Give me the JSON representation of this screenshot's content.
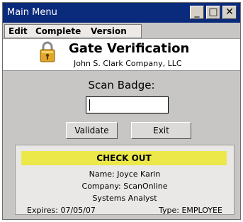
{
  "window": {
    "title": "Main Menu"
  },
  "titlebar_buttons": {
    "minimize": "_",
    "maximize": "□",
    "close": "✕"
  },
  "menu": [
    "Edit",
    "Complete",
    "Version"
  ],
  "header": {
    "title": "Gate Verification",
    "subtitle": "John S. Clark Company, LLC",
    "icon": "lock-icon"
  },
  "scan": {
    "label": "Scan Badge:",
    "value": ""
  },
  "buttons": {
    "validate": "Validate",
    "exit": "Exit"
  },
  "result": {
    "status": "CHECK OUT",
    "name": "Name: Joyce Karin",
    "company": "Company: ScanOnline",
    "title": "Systems Analyst",
    "expires": "Expires: 07/05/07",
    "type": "Type: EMPLOYEE",
    "status_color": "#ece84a"
  },
  "colors": {
    "titlebar": "#0a2a7c",
    "window_bg": "#c8c6c4",
    "lock": "#e0a826"
  }
}
